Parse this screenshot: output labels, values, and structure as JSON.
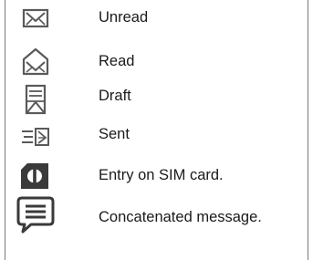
{
  "legend": {
    "items": [
      {
        "icon": "envelope-closed-icon",
        "label": "Unread"
      },
      {
        "icon": "envelope-open-icon",
        "label": "Read"
      },
      {
        "icon": "draft-document-icon",
        "label": "Draft"
      },
      {
        "icon": "sent-message-icon",
        "label": "Sent"
      },
      {
        "icon": "sim-card-icon",
        "label": "Entry on SIM card."
      },
      {
        "icon": "speech-bubble-icon",
        "label": "Concatenated message."
      }
    ]
  },
  "colors": {
    "icon": "#5a5a5a",
    "icon_dark": "#3a3a3a",
    "rule": "#7a7a7a"
  }
}
